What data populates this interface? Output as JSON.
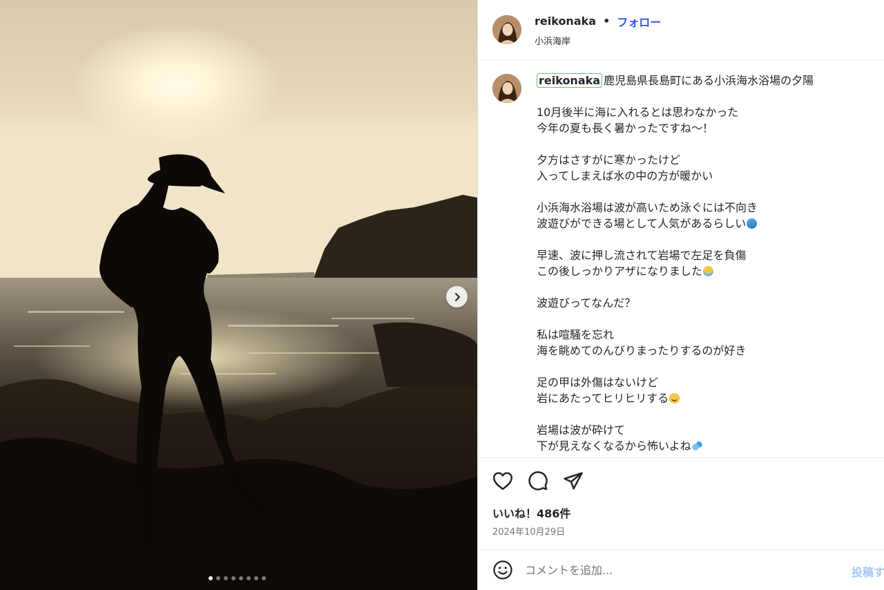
{
  "header": {
    "username": "reikonaka",
    "separator": "•",
    "follow_label": "フォロー",
    "location": "小浜海岸"
  },
  "caption": {
    "username": "reikonaka",
    "first_line": "鹿児島県長島町にある小浜海水浴場の夕陽",
    "paragraphs": [
      [
        "10月後半に海に入れるとは思わなかった",
        "今年の夏も長く暑かったですね〜！"
      ],
      [
        "夕方はさすがに寒かったけど",
        "入ってしまえば水の中の方が暖かい"
      ],
      [
        "小浜海水浴場は波が高いため泳ぐには不向き",
        "波遊びができる場として人気があるらしい"
      ],
      [
        "早速、波に押し流されて岩場で左足を負傷",
        "この後しっかりアザになりました"
      ],
      [
        "波遊びってなんだ？"
      ],
      [
        "私は喧騒を忘れ",
        "海を眺めてのんびりまったりするのが好き"
      ],
      [
        "足の甲は外傷はないけど",
        "岩にあたってヒリヒリする"
      ],
      [
        "岩場は波が砕けて",
        "下が見えなくなるから怖いよね"
      ]
    ],
    "emojis": {
      "wave": "wave-emoji",
      "crying": "crying-face-emoji",
      "pleading": "pleading-face-emoji",
      "sweat": "sweat-droplets-emoji"
    }
  },
  "actions": {
    "icons": [
      "heart-icon",
      "comment-icon",
      "share-icon"
    ]
  },
  "likes_label": "いいね！486件",
  "date_label": "2024年10月29日",
  "comment": {
    "placeholder": "コメントを追加...",
    "post_label": "投稿する"
  },
  "carousel": {
    "slide_count": 8,
    "active_index": 0
  },
  "colors": {
    "accent": "#2a56e6",
    "post_disabled": "#a5c8f3",
    "highlight_border": "#6cc36c"
  }
}
